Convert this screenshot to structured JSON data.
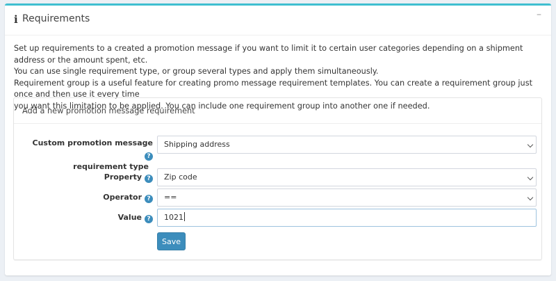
{
  "header": {
    "icon": "info-icon",
    "title": "Requirements",
    "collapse_label": "–"
  },
  "description": {
    "line1": "Set up requirements to a created a promotion message if you want to limit it to certain user categories depending on a shipment address or the amount spent, etc.",
    "line2": "You can use single requirement type, or group several types and apply them simultaneously.",
    "line3": "Requirement group is a useful feature for creating promo message requirement templates. You can create a requirement group just once and then use it every time",
    "line4": "you want this limitation to be applied. You can include one requirement group into another one if needed."
  },
  "form": {
    "title": "Add a new promotion message requirement",
    "requirement_type": {
      "label_line1": "Custom promotion message",
      "label_line2": "requirement type",
      "value": "Shipping address"
    },
    "property": {
      "label": "Property",
      "value": "Zip code"
    },
    "operator": {
      "label": "Operator",
      "value": "=="
    },
    "value_field": {
      "label": "Value",
      "value": "1021"
    },
    "help_glyph": "?",
    "save_label": "Save"
  },
  "colors": {
    "accent_border": "#3fbfd0",
    "primary": "#3c8dbc"
  }
}
